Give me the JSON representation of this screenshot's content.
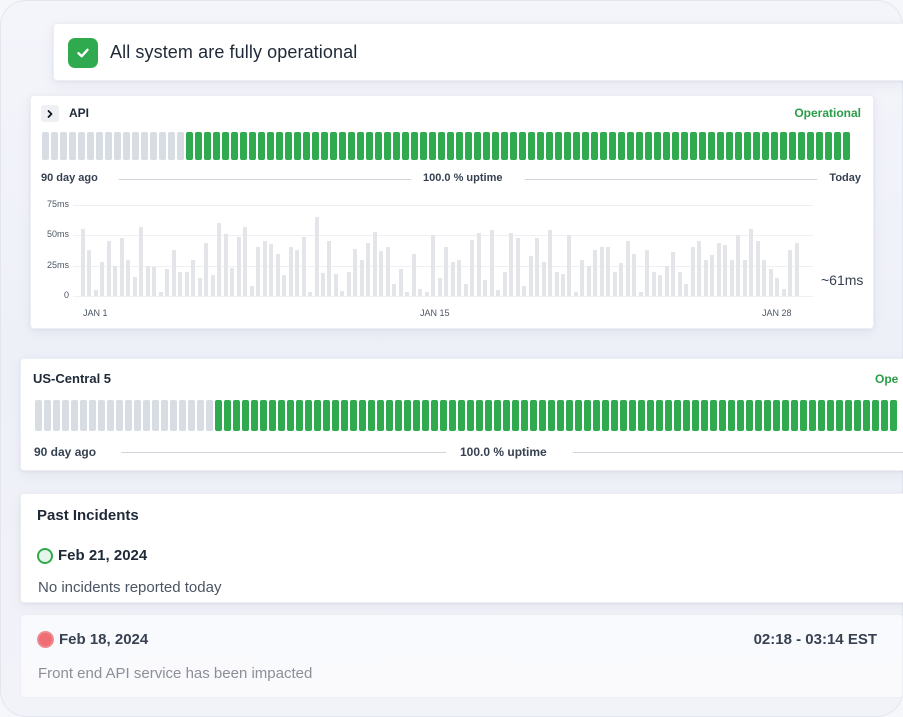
{
  "banner": {
    "title": "All system are fully operational",
    "icon": "check-icon"
  },
  "colors": {
    "up": "#2faa4f",
    "unknown": "#d8dce3",
    "accent_green": "#2a9d48",
    "incident_red": "#ee6e74",
    "latency_bar": "#e3e5e9"
  },
  "services": [
    {
      "name": "API",
      "status": "Operational",
      "uptime_text": "100.0 % uptime",
      "start_label": "90 day ago",
      "end_label": "Today",
      "days_total": 90,
      "days_unknown": 16,
      "days_up": 74,
      "expand_icon": "chevron-right-icon"
    },
    {
      "name": "US-Central 5",
      "status": "Ope",
      "uptime_text": "100.0 % uptime",
      "start_label": "90 day ago",
      "days_unknown": 20,
      "days_up": 76
    }
  ],
  "chart_data": {
    "type": "bar",
    "title": "",
    "ylabel": "",
    "xlabel": "",
    "y_ticks": [
      "75ms",
      "50ms",
      "25ms",
      "0"
    ],
    "ylim": [
      0,
      75
    ],
    "x_labels": [
      "JAN 1",
      "JAN 15",
      "JAN 28"
    ],
    "average_label": "~61ms",
    "values": [
      55,
      38,
      5,
      28,
      45,
      25,
      48,
      30,
      16,
      57,
      25,
      24,
      3,
      22,
      38,
      20,
      20,
      30,
      15,
      44,
      17,
      60,
      51,
      23,
      49,
      57,
      8,
      40,
      45,
      43,
      35,
      17,
      40,
      38,
      49,
      3,
      65,
      19,
      45,
      18,
      4,
      20,
      39,
      30,
      44,
      53,
      37,
      40,
      10,
      22,
      3,
      35,
      6,
      3,
      50,
      15,
      40,
      28,
      30,
      10,
      46,
      52,
      13,
      54,
      5,
      20,
      52,
      48,
      8,
      33,
      48,
      28,
      54,
      20,
      18,
      50,
      3,
      30,
      25,
      38,
      40,
      40,
      20,
      27,
      45,
      35,
      3,
      38,
      20,
      17,
      25,
      36,
      20,
      10,
      40,
      45,
      30,
      34,
      44,
      42,
      30,
      50,
      30,
      55,
      45,
      30,
      22,
      15,
      6,
      38,
      44
    ]
  },
  "incidents": {
    "heading": "Past Incidents",
    "items": [
      {
        "date": "Feb 21, 2024",
        "description": "No incidents reported today",
        "status": "none"
      },
      {
        "date": "Feb 18, 2024",
        "time_range": "02:18 - 03:14 EST",
        "description": "Front end API service has been impacted",
        "status": "incident"
      }
    ]
  }
}
